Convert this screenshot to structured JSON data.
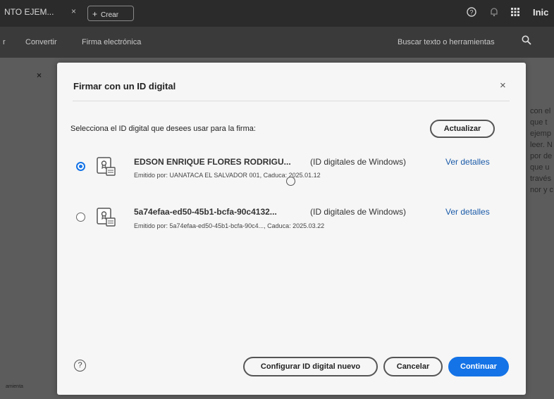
{
  "app": {
    "document_tab": "NTO EJEM...",
    "tab_close": "×",
    "create_label": "Crear",
    "start_label": "Inic",
    "icons": [
      "help-icon",
      "bell-icon",
      "apps-grid-icon"
    ]
  },
  "toolbar": {
    "items": [
      "r",
      "Convertir",
      "Firma electrónica"
    ],
    "search_label": "Buscar texto o herramientas",
    "search_icon": "search-icon"
  },
  "background": {
    "left_close": "×",
    "left_footer": "amienta",
    "right_lines": [
      "con el",
      "que t",
      "ejemp",
      "leer. N",
      "por de",
      "que u",
      "través",
      "nor y c"
    ]
  },
  "dialog": {
    "title": "Firmar con un ID digital",
    "close": "×",
    "instruction": "Selecciona el ID digital que desees usar para la firma:",
    "refresh_label": "Actualizar",
    "ids": [
      {
        "name": "EDSON ENRIQUE FLORES RODRIGU...",
        "type": "(ID digitales de Windows)",
        "issuer": "Emitido por: UANATACA EL SALVADOR 001, Caduca: 2025.01.12",
        "details_label": "Ver detalles",
        "selected": true
      },
      {
        "name": "5a74efaa-ed50-45b1-bcfa-90c4132...",
        "type": "(ID digitales de Windows)",
        "issuer": "Emitido por: 5a74efaa-ed50-45b1-bcfa-90c4..., Caduca: 2025.03.22",
        "details_label": "Ver detalles",
        "selected": false
      }
    ],
    "help": "?",
    "buttons": {
      "configure": "Configurar ID digital nuevo",
      "cancel": "Cancelar",
      "continue": "Continuar"
    }
  },
  "colors": {
    "accent": "#1473e6",
    "link": "#1a5aa8"
  }
}
